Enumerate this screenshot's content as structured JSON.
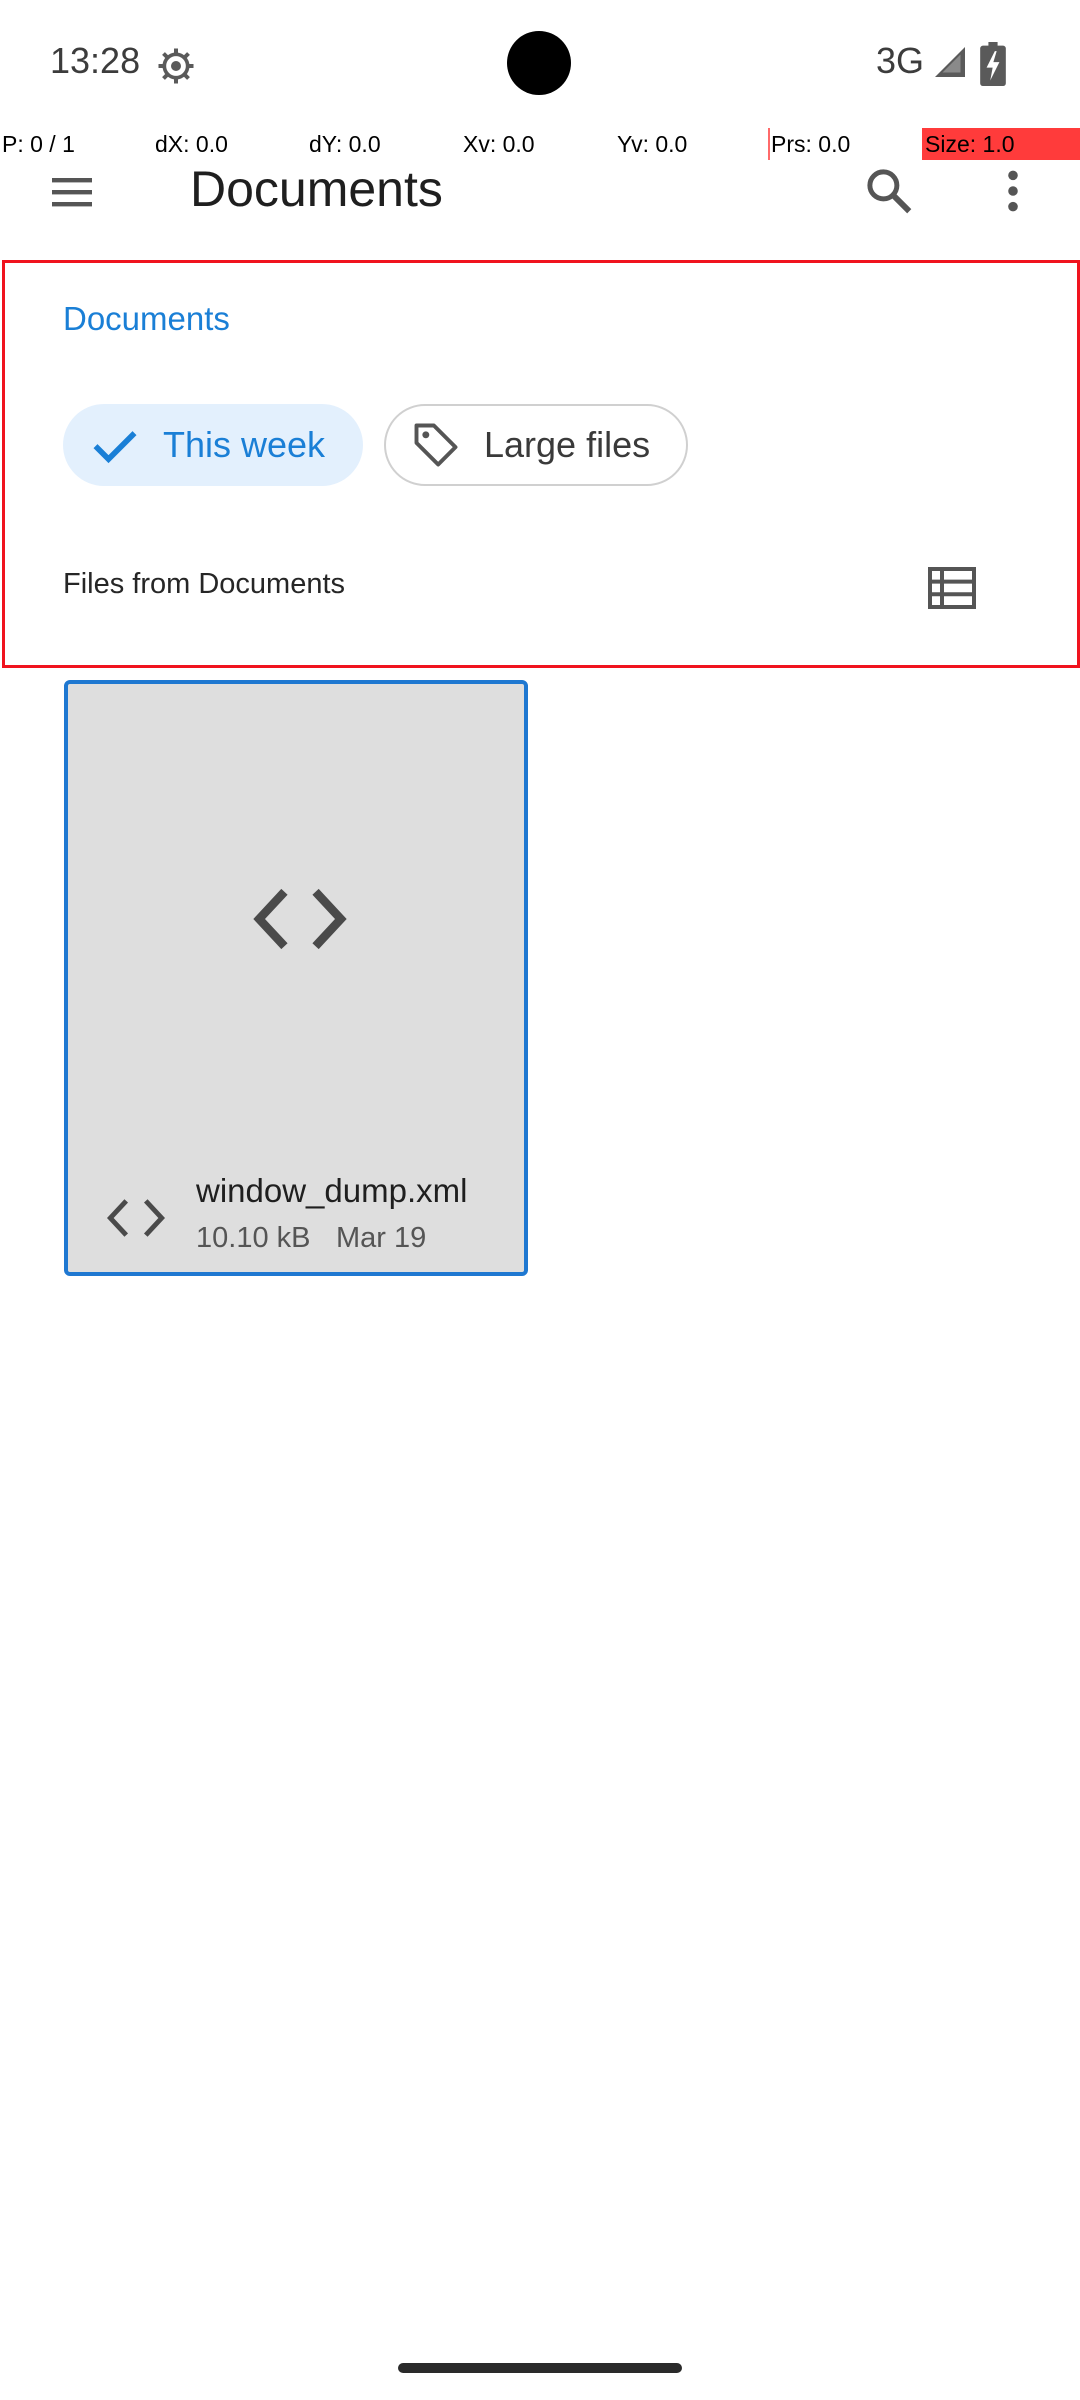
{
  "status_bar": {
    "time": "13:28",
    "network": "3G",
    "icons": [
      "settings-gear-icon",
      "signal-icon",
      "battery-charging-icon"
    ]
  },
  "pointer_overlay": {
    "p": "P: 0 / 1",
    "dx": "dX: 0.0",
    "dy": "dY: 0.0",
    "xv": "Xv: 0.0",
    "yv": "Yv: 0.0",
    "prs": "Prs: 0.0",
    "size": "Size: 1.0"
  },
  "toolbar": {
    "title": "Documents",
    "icons": [
      "menu-icon",
      "search-icon",
      "more-vert-icon"
    ]
  },
  "section": {
    "title": "Documents"
  },
  "chips": [
    {
      "label": "This week",
      "selected": true,
      "icon": "check-icon"
    },
    {
      "label": "Large files",
      "selected": false,
      "icon": "tag-icon"
    }
  ],
  "files_header": {
    "label": "Files from Documents",
    "view_icon": "list-view-icon"
  },
  "files": [
    {
      "name": "window_dump.xml",
      "size": "10.10 kB",
      "date": "Mar 19",
      "icon": "code-icon"
    }
  ],
  "colors": {
    "accent": "#1a7fd6",
    "chip_selected_bg": "#e3f0fd",
    "highlight_border": "#f0131e",
    "card_bg": "#dedede",
    "card_border": "#1f78d1"
  }
}
